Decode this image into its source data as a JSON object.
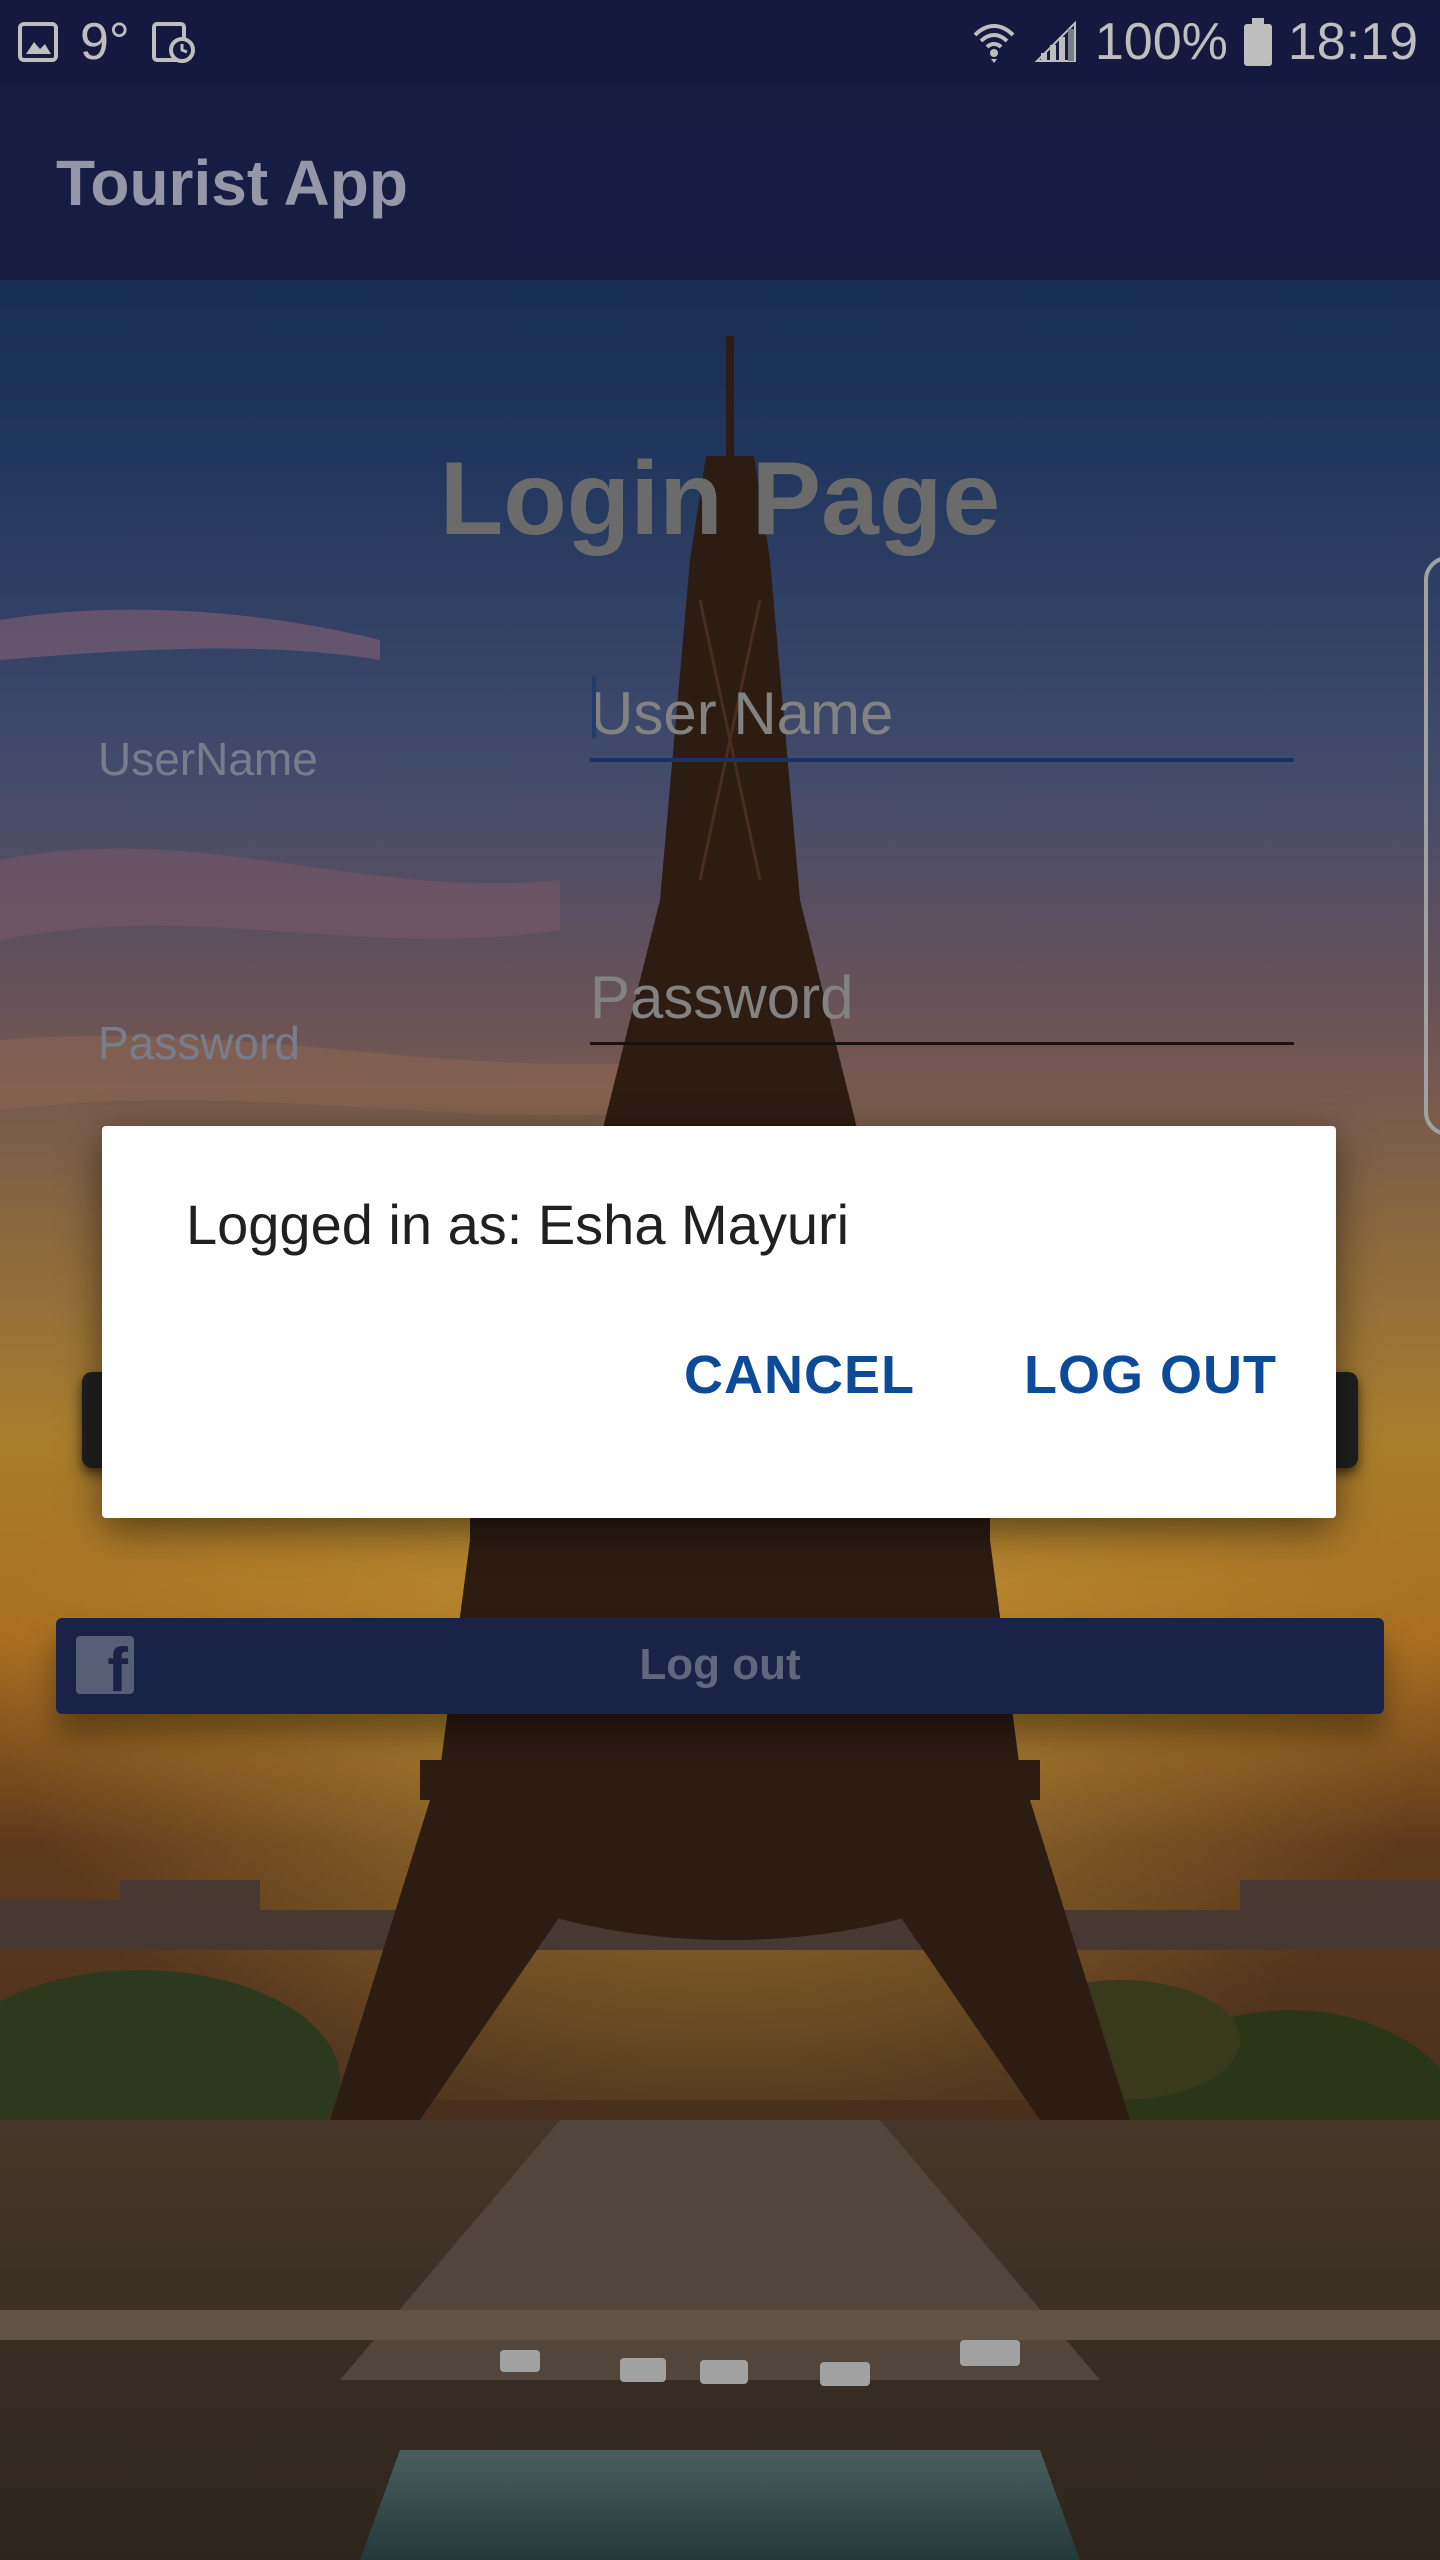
{
  "status_bar": {
    "temperature": "9°",
    "battery_percent": "100%",
    "time": "18:19",
    "icons": [
      "gallery-icon",
      "calendar-clock-icon",
      "wifi-icon",
      "cell-signal-icon",
      "battery-icon"
    ]
  },
  "app_bar": {
    "title": "Tourist App"
  },
  "login": {
    "title": "Login Page",
    "username_label": "UserName",
    "username_placeholder": "User Name",
    "password_label": "Password",
    "password_placeholder": "Password"
  },
  "facebook": {
    "icon": "facebook-icon",
    "label": "Log out"
  },
  "dialog": {
    "message": "Logged in as: Esha Mayuri",
    "cancel_label": "CANCEL",
    "logout_label": "LOG OUT"
  },
  "colors": {
    "status_bar": "#1c2151",
    "app_bar": "#1e2457",
    "accent_button_text": "#0d4a97",
    "facebook_bar": "#1f2d5c"
  }
}
